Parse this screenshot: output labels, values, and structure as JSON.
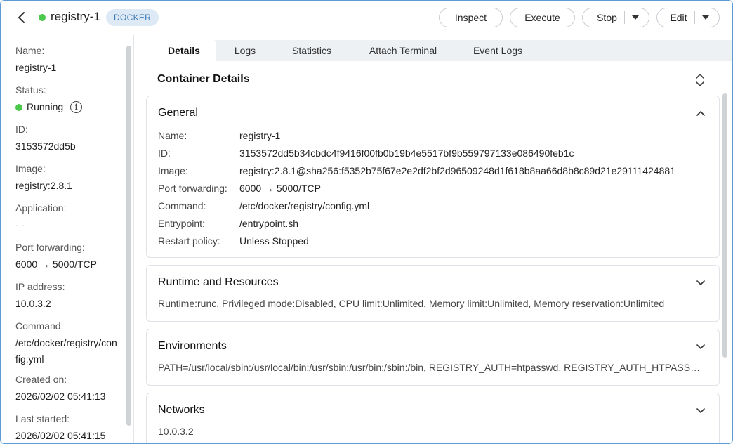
{
  "header": {
    "title": "registry-1",
    "badge": "DOCKER",
    "status_color": "#4cc94c",
    "buttons": {
      "inspect": "Inspect",
      "execute": "Execute",
      "stop": "Stop",
      "edit": "Edit"
    }
  },
  "sidebar": {
    "name_label": "Name:",
    "name_value": "registry-1",
    "status_label": "Status:",
    "status_value": "Running",
    "id_label": "ID:",
    "id_value": "3153572dd5b",
    "image_label": "Image:",
    "image_value": "registry:2.8.1",
    "application_label": "Application:",
    "application_value": "- -",
    "port_label": "Port forwarding:",
    "port_value": "6000 → 5000/TCP",
    "ip_label": "IP address:",
    "ip_value": "10.0.3.2",
    "command_label": "Command:",
    "command_value_line1": "/etc/docker/registry/con",
    "command_value_line2": "fig.yml",
    "created_label": "Created on:",
    "created_value": "2026/02/02 05:41:13",
    "started_label": "Last started:",
    "started_value": "2026/02/02 05:41:15"
  },
  "tabs": [
    "Details",
    "Logs",
    "Statistics",
    "Attach Terminal",
    "Event Logs"
  ],
  "container_details_title": "Container Details",
  "general": {
    "title": "General",
    "rows": [
      {
        "key": "Name:",
        "value": "registry-1"
      },
      {
        "key": "ID:",
        "value": "3153572dd5b34cbdc4f9416f00fb0b19b4e5517bf9b559797133e086490feb1c"
      },
      {
        "key": "Image:",
        "value": "registry:2.8.1@sha256:f5352b75f67e2e2df2bf2d96509248d1f618b8aa66d8b8c89d21e29111424881"
      },
      {
        "key": "Port forwarding:",
        "value": "6000 → 5000/TCP"
      },
      {
        "key": "Command:",
        "value": "/etc/docker/registry/config.yml"
      },
      {
        "key": "Entrypoint:",
        "value": "/entrypoint.sh"
      },
      {
        "key": "Restart policy:",
        "value": "Unless Stopped"
      }
    ]
  },
  "runtime": {
    "title": "Runtime and Resources",
    "summary": "Runtime:runc, Privileged mode:Disabled, CPU limit:Unlimited, Memory limit:Unlimited, Memory reservation:Unlimited"
  },
  "environments": {
    "title": "Environments",
    "summary": "PATH=/usr/local/sbin:/usr/local/bin:/usr/sbin:/usr/bin:/sbin:/bin, REGISTRY_AUTH=htpasswd, REGISTRY_AUTH_HTPASSWD_REALM=Registry Realm"
  },
  "networks": {
    "title": "Networks",
    "summary": "10.0.3.2"
  }
}
